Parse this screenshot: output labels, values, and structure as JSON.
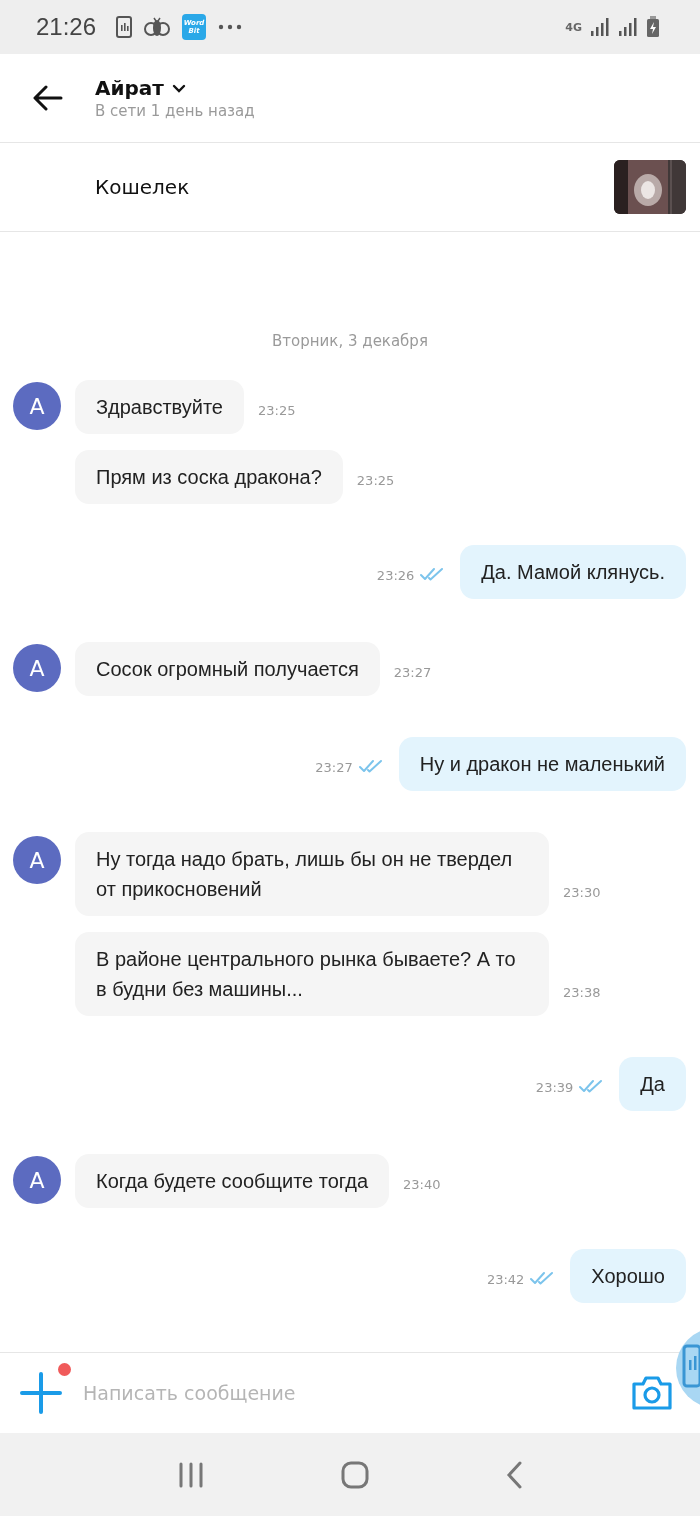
{
  "status_bar": {
    "time": "21:26",
    "app_icon_lines": [
      "Word",
      "Bit"
    ],
    "network": "4G"
  },
  "header": {
    "name": "Айрат",
    "subtitle": "В сети 1 день назад"
  },
  "listing": {
    "title": "Кошелек"
  },
  "date": "Вторник, 3 декабря",
  "groups": [
    {
      "kind": "in",
      "avatar": "А",
      "messages": [
        {
          "text": "Здравствуйте",
          "time": "23:25"
        },
        {
          "text": "Прям из соска дракона?",
          "time": "23:25"
        }
      ]
    },
    {
      "kind": "out",
      "messages": [
        {
          "text": "Да. Мамой клянусь.",
          "time": "23:26",
          "read": true
        }
      ]
    },
    {
      "kind": "in",
      "avatar": "А",
      "messages": [
        {
          "text": "Сосок огромный получается",
          "time": "23:27"
        }
      ]
    },
    {
      "kind": "out",
      "messages": [
        {
          "text": "Ну и дракон не маленький",
          "time": "23:27",
          "read": true
        }
      ]
    },
    {
      "kind": "in",
      "avatar": "А",
      "messages": [
        {
          "text": "Ну тогда надо брать, лишь бы он не твердел от прикосновений",
          "time": "23:30"
        },
        {
          "text": "В районе центрального рынка бываете? А то в будни без машины...",
          "time": "23:38"
        }
      ]
    },
    {
      "kind": "out",
      "messages": [
        {
          "text": "Да",
          "time": "23:39",
          "read": true
        }
      ]
    },
    {
      "kind": "in",
      "avatar": "А",
      "messages": [
        {
          "text": "Когда будете сообщите тогда",
          "time": "23:40"
        }
      ]
    },
    {
      "kind": "out",
      "messages": [
        {
          "text": "Хорошо",
          "time": "23:42",
          "read": true
        }
      ]
    }
  ],
  "composer": {
    "placeholder": "Написать сообщение",
    "attach_badge": true
  }
}
